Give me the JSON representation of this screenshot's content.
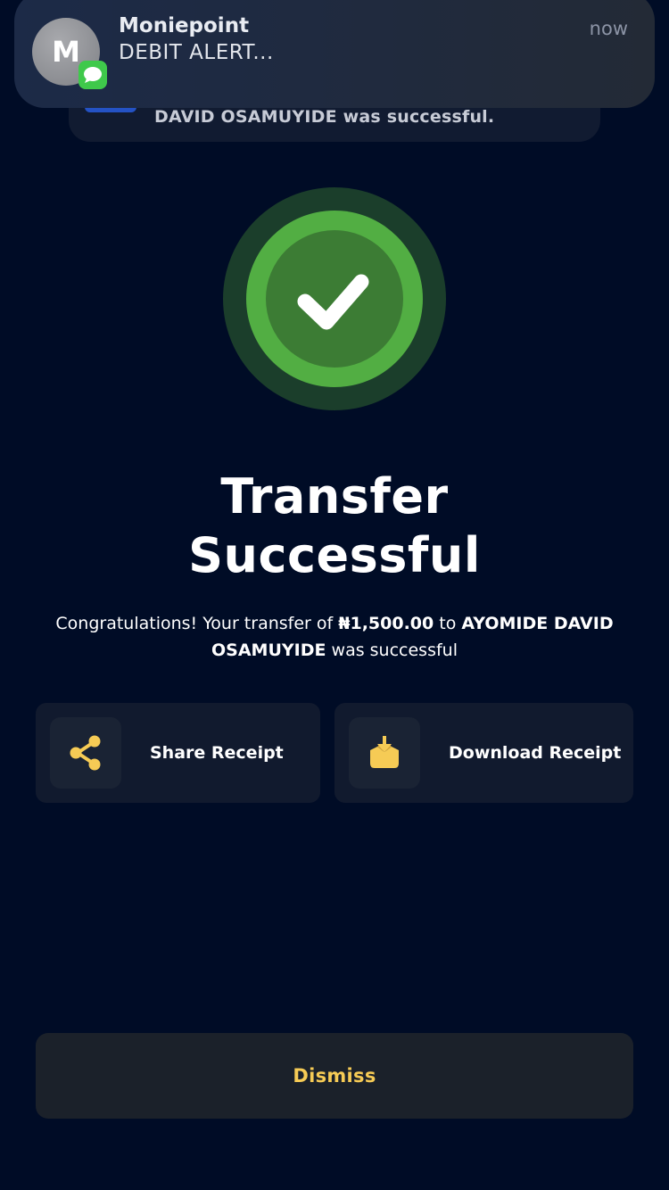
{
  "notification": {
    "app_initial": "M",
    "title": "Moniepoint",
    "body": "DEBIT ALERT...",
    "time": "now"
  },
  "background_banner": {
    "text": "DAVID OSAMUYIDE was successful."
  },
  "status": {
    "icon": "checkmark-icon",
    "title_line1": "Transfer",
    "title_line2": "Successful"
  },
  "message": {
    "prefix": "Congratulations! Your transfer of",
    "amount": "₦1,500.00",
    "middle": "to",
    "recipient": "AYOMIDE DAVID OSAMUYIDE",
    "suffix": "was successful"
  },
  "actions": [
    {
      "label": "Share Receipt",
      "icon": "share-icon"
    },
    {
      "label": "Download Receipt",
      "icon": "download-icon"
    }
  ],
  "dismiss_label": "Dismiss",
  "colors": {
    "background": "#000c26",
    "accent": "#f6cb55",
    "success_green": "#52ae43",
    "success_dark": "#1b3e2b"
  }
}
